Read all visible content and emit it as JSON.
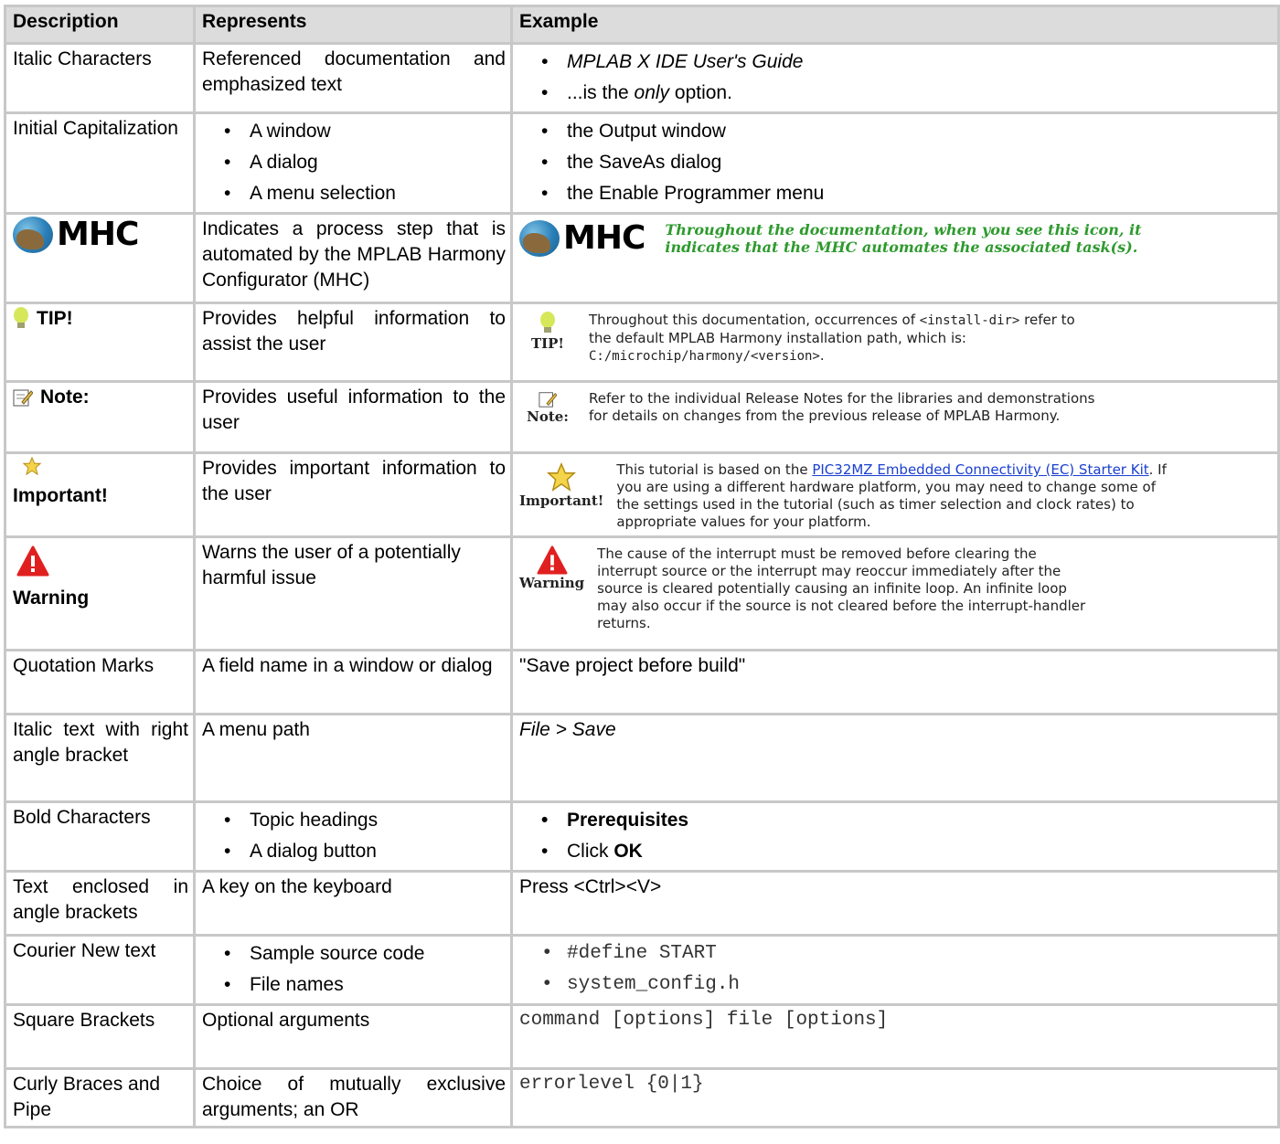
{
  "headers": [
    "Description",
    "Represents",
    "Example"
  ],
  "rows": {
    "italic": {
      "d": "Italic Characters",
      "r": "Referenced documentation and emphasized text",
      "e1": "MPLAB X IDE User's Guide",
      "e2a": "...is the ",
      "e2b": "only",
      "e2c": " option."
    },
    "initial": {
      "d": "Initial Capitalization",
      "r1": "A window",
      "r2": "A dialog",
      "r3": "A menu selection",
      "e1": "the Output window",
      "e2": "the SaveAs dialog",
      "e3": "the Enable Programmer menu"
    },
    "mhc": {
      "icon_label": "MHC",
      "r": "Indicates a process step that is automated by the MPLAB Harmony Configurator (MHC)",
      "e": "Throughout the documentation, when you see this icon, it indicates that the MHC automates the associated task(s)."
    },
    "tip": {
      "d": "TIP!",
      "r": "Provides helpful information to assist the user",
      "lab": "TIP!",
      "e1": "Throughout this documentation, occurrences of ",
      "e1m": "<install-dir>",
      "e2": "refer to the default MPLAB Harmony installation path, which is:",
      "e3m": "C:/microchip/harmony/<version>",
      "e3": "."
    },
    "note": {
      "d": "Note:",
      "r": "Provides useful information to the user",
      "lab": "Note:",
      "e": "Refer to the individual Release Notes for the libraries and demonstrations for details on changes from the previous release of MPLAB Harmony."
    },
    "important": {
      "d": "Important!",
      "r": "Provides important information to the user",
      "lab": "Important!",
      "e1": "This tutorial is based on the ",
      "link": "PIC32MZ Embedded Connectivity (EC) Starter Kit",
      "e2": ". If you are using a different hardware platform, you may need to change some of the settings used in the tutorial (such as timer selection and clock rates) to appropriate values for your platform."
    },
    "warning": {
      "d": "Warning",
      "r": "Warns the user of a potentially harmful issue",
      "lab": "Warning",
      "e": "The cause of the interrupt must be removed before clearing the interrupt source or the interrupt may reoccur immediately after the source is cleared potentially causing an infinite loop. An infinite loop may also occur if the source is not cleared before the interrupt-handler returns."
    },
    "quote": {
      "d": "Quotation Marks",
      "r": "A field name in a window or dialog",
      "e": "\"Save project before build\""
    },
    "angle": {
      "d": "Italic text with right angle bracket",
      "r": "A menu path",
      "e": "File > Save"
    },
    "bold": {
      "d": "Bold Characters",
      "r1": "Topic headings",
      "r2": "A dialog button",
      "e1": "Prerequisites",
      "e2a": "Click ",
      "e2b": "OK"
    },
    "keys": {
      "d": "Text enclosed in angle brackets",
      "r": "A key on the keyboard",
      "e": "Press <Ctrl><V>"
    },
    "courier": {
      "d": "Courier New text",
      "r1": "Sample source code",
      "r2": "File names",
      "e1": "#define START",
      "e2": "system_config.h"
    },
    "square": {
      "d": "Square Brackets",
      "r": "Optional arguments",
      "e": "command [options] file [options]"
    },
    "curly": {
      "d": "Curly Braces and Pipe",
      "r": "Choice of mutually exclusive arguments; an OR",
      "e": "errorlevel {0|1}"
    }
  }
}
